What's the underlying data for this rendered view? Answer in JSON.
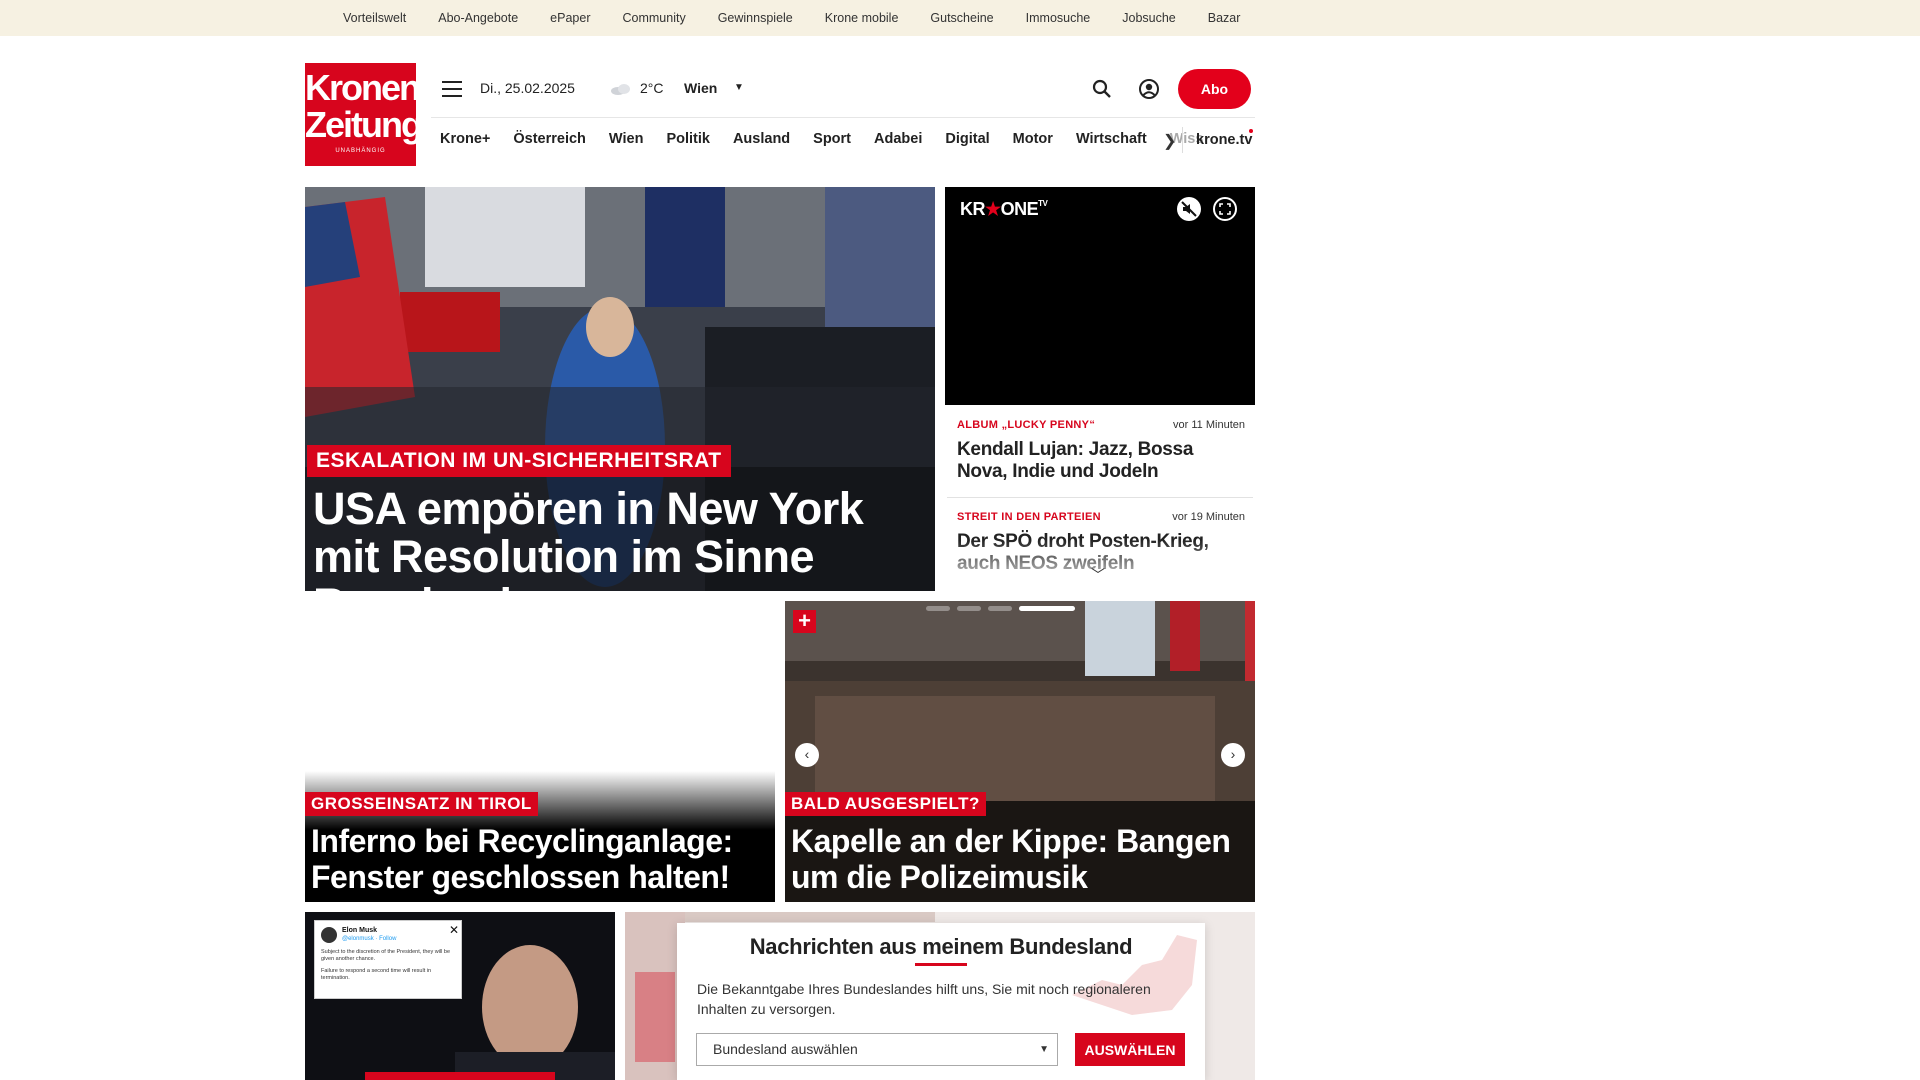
{
  "topbar": {
    "links": [
      "Vorteilswelt",
      "Abo-Angebote",
      "ePaper",
      "Community",
      "Gewinnspiele",
      "Krone mobile",
      "Gutscheine",
      "Immosuche",
      "Jobsuche",
      "Bazar"
    ]
  },
  "header": {
    "logo": {
      "line1": "Kronen",
      "line2": "Zeitung",
      "line3": "UNABHÄNGIG"
    },
    "date": "Di., 25.02.2025",
    "weather": {
      "icon": "cloud-icon",
      "temp": "2°C"
    },
    "city": "Wien",
    "abo_label": "Abo"
  },
  "nav": {
    "items": [
      "Krone+",
      "Österreich",
      "Wien",
      "Politik",
      "Ausland",
      "Sport",
      "Adabei",
      "Digital",
      "Motor",
      "Wirtschaft",
      "Wiss"
    ],
    "tv": "krone.tv"
  },
  "hero": {
    "kicker": "ESKALATION IM UN-SICHERHEITSRAT",
    "title": "USA empören in New York mit Resolution im Sinne Russlands"
  },
  "video": {
    "logo": "KR",
    "logo_rest": "ONE",
    "logo_sup": "TV"
  },
  "sidebar": {
    "items": [
      {
        "kicker": "ALBUM „LUCKY PENNY“",
        "time": "vor 11 Minuten",
        "title": "Kendall Lujan: Jazz, Bossa Nova, Indie und Jodeln"
      },
      {
        "kicker": "STREIT IN DEN PARTEIEN",
        "time": "vor 19 Minuten",
        "title": "Der SPÖ droht Posten-Krieg, auch NEOS zweifeln"
      }
    ]
  },
  "tiles": [
    {
      "kicker": "GROSSEINSATZ IN TIROL",
      "title": "Inferno bei Recyclinganlage: Fenster geschlossen halten!"
    },
    {
      "kicker": "BALD AUSGESPIELT?",
      "title": "Kapelle an der Kippe: Bangen um die Polizeimusik",
      "plus": "+"
    }
  ],
  "tweet": {
    "name": "Elon Musk",
    "handle": "@elonmusk · Follow",
    "text1": "Subject to the discretion of the President, they will be given another chance.",
    "text2": "Failure to respond a second time will result in termination."
  },
  "modal": {
    "title": "Nachrichten aus meinem Bundesland",
    "text": "Die Bekanntgabe Ihres Bundeslandes hilft uns, Sie mit noch regionaleren Inhalten zu versorgen.",
    "select_placeholder": "Bundesland auswählen",
    "button": "AUSWÄHLEN"
  },
  "colors": {
    "brand_red": "#d7051d",
    "topbar_bg": "#f6f1e2"
  }
}
